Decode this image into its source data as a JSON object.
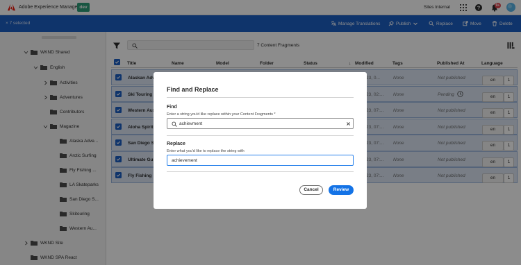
{
  "app": {
    "name": "Adobe Experience Manager",
    "env_badge": "dev",
    "org": "Sites Internal",
    "notif_count": "9+"
  },
  "actionbar": {
    "selected": "7 selected",
    "actions": [
      "Manage Translations",
      "Publish",
      "Replace",
      "Move",
      "Delete"
    ]
  },
  "sidebar": {
    "items": [
      {
        "label": "WKND Shared",
        "depth": 0,
        "expanded": true
      },
      {
        "label": "English",
        "depth": 1,
        "expanded": true
      },
      {
        "label": "Activities",
        "depth": 2,
        "expanded": false
      },
      {
        "label": "Adventures",
        "depth": 2,
        "expanded": false
      },
      {
        "label": "Contributors",
        "depth": 2,
        "expanded": null
      },
      {
        "label": "Magazine",
        "depth": 2,
        "expanded": true
      },
      {
        "label": "Alaska Adve...",
        "depth": 3,
        "expanded": null
      },
      {
        "label": "Arctic Surfing",
        "depth": 3,
        "expanded": null
      },
      {
        "label": "Fly Fishing ...",
        "depth": 3,
        "expanded": null
      },
      {
        "label": "LA Skateparks",
        "depth": 3,
        "expanded": null
      },
      {
        "label": "San Diego S...",
        "depth": 3,
        "expanded": null
      },
      {
        "label": "Skitouring",
        "depth": 3,
        "expanded": null
      },
      {
        "label": "Western Au...",
        "depth": 3,
        "expanded": null
      },
      {
        "label": "WKND Site",
        "depth": 0,
        "expanded": false
      },
      {
        "label": "WKND SPA React",
        "depth": 0,
        "expanded": null
      }
    ]
  },
  "content": {
    "count_label": "7 Content Fragments",
    "columns": [
      "Title",
      "Name",
      "Model",
      "Folder",
      "Status",
      "Modified",
      "Tags",
      "Published At",
      "Language"
    ],
    "rows": [
      {
        "title": "Alaskan Adve",
        "modified": "23, 0...",
        "tags": "None",
        "published": "Not published",
        "lang": "en",
        "versions": "1"
      },
      {
        "title": "Ski Touring",
        "modified": "23, 02:...",
        "tags": "None",
        "published": "Pending",
        "lang": "en",
        "versions": "1"
      },
      {
        "title": "Western Aust",
        "modified": "23, 07:...",
        "tags": "None",
        "published": "Not published",
        "lang": "en",
        "versions": "1"
      },
      {
        "title": "Aloha Spirits",
        "modified": "23, 07:...",
        "tags": "None",
        "published": "Not published",
        "lang": "en",
        "versions": "1"
      },
      {
        "title": "San Diego Su",
        "modified": "23, 07:...",
        "tags": "None",
        "published": "Not published",
        "lang": "en",
        "versions": "1"
      },
      {
        "title": "Ultimate Guid",
        "modified": "23, 07:...",
        "tags": "None",
        "published": "Not published",
        "lang": "en",
        "versions": "1"
      },
      {
        "title": "Fly Fishing",
        "modified": "23, 07:...",
        "tags": "None",
        "published": "Not published",
        "lang": "en",
        "versions": "1"
      }
    ]
  },
  "dialog": {
    "title": "Find and Replace",
    "find_label": "Find",
    "find_help": "Enter a string you'd like replace within your Content Fragments",
    "find_value": "achievment",
    "replace_label": "Replace",
    "replace_help": "Enter what you'd like to replace the string with",
    "replace_value": "achievement",
    "cancel": "Cancel",
    "review": "Review"
  },
  "colors": {
    "accent": "#1d5fc4",
    "cta": "#1473e6",
    "env_badge": "#2d9d78",
    "notif": "#e34850"
  }
}
